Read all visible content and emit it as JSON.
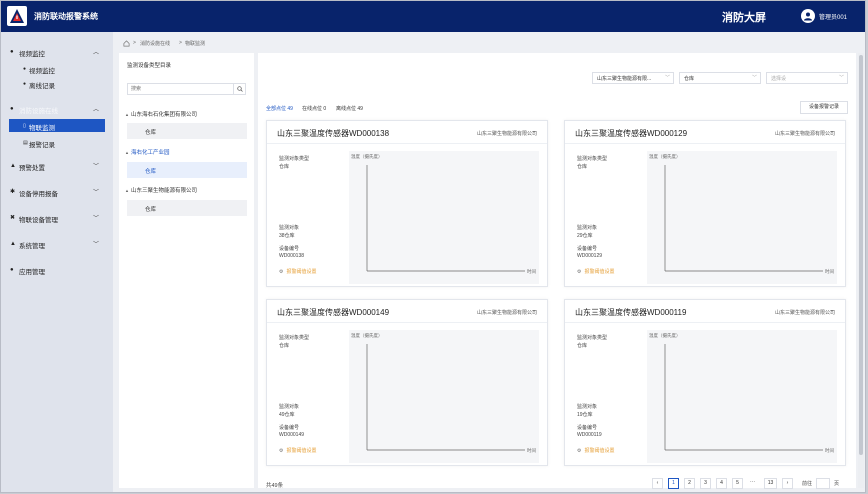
{
  "header": {
    "app_title": "消防联动报警系统",
    "big_screen": "消防大屏",
    "user_name": "管理员001"
  },
  "sidebar": {
    "groups": [
      {
        "label": "视频监控",
        "icon": "video-icon",
        "expanded": true,
        "children": [
          {
            "label": "视频监控"
          },
          {
            "label": "离线记录"
          }
        ]
      },
      {
        "label": "消防设施在线",
        "icon": "fire-icon",
        "expanded": true,
        "children": [
          {
            "label": "物联监测",
            "active": true
          },
          {
            "label": "报警记录"
          }
        ]
      },
      {
        "label": "预警处置",
        "icon": "warning-icon",
        "expanded": false
      },
      {
        "label": "设备停用报备",
        "icon": "device-icon",
        "expanded": false
      },
      {
        "label": "物联设备管理",
        "icon": "iot-icon",
        "expanded": false
      },
      {
        "label": "系统管理",
        "icon": "system-icon",
        "expanded": false
      },
      {
        "label": "应用管理",
        "icon": "app-icon",
        "expanded": false
      }
    ]
  },
  "breadcrumb": [
    "消防设施在线",
    "物联监测"
  ],
  "tree": {
    "title": "监测设备类型目录",
    "search_placeholder": "搜索",
    "nodes": [
      {
        "label": "山东海右石化集团有限公司",
        "children": [
          "仓库"
        ]
      },
      {
        "label": "海右化工产业园",
        "selected": true,
        "children": [
          "仓库"
        ]
      },
      {
        "label": "山东三聚生物能源有限公司",
        "children": [
          "仓库"
        ]
      }
    ]
  },
  "filters": {
    "company": "山东三聚生物能源有限...",
    "area": "仓库",
    "device_type_placeholder": "选择设"
  },
  "tabs": [
    {
      "label": "全部点位 49",
      "active": true
    },
    {
      "label": "在线点位 0"
    },
    {
      "label": "离线点位 49"
    }
  ],
  "alarm_button": "设备报警记录",
  "card_labels": {
    "object_type": "监测对象类型",
    "object": "监测对象",
    "device_no": "设备编号",
    "threshold": "报警阈值设置",
    "chart_ylabel": "温度（摄氏度）",
    "chart_xlabel": "时间"
  },
  "cards": [
    {
      "title": "山东三聚温度传感器WD000138",
      "org": "山东三聚生物能源有限公司",
      "object_type": "仓库",
      "object": "38仓库",
      "device_no": "WD000138"
    },
    {
      "title": "山东三聚温度传感器WD000129",
      "org": "山东三聚生物能源有限公司",
      "object_type": "仓库",
      "object": "29仓库",
      "device_no": "WD000129"
    },
    {
      "title": "山东三聚温度传感器WD000149",
      "org": "山东三聚生物能源有限公司",
      "object_type": "仓库",
      "object": "49仓库",
      "device_no": "WD000149"
    },
    {
      "title": "山东三聚温度传感器WD000119",
      "org": "山东三聚生物能源有限公司",
      "object_type": "仓库",
      "object": "19仓库",
      "device_no": "WD000119"
    }
  ],
  "pagination": {
    "total": "共49条",
    "pages": [
      "1",
      "2",
      "3",
      "4",
      "5",
      "···",
      "13"
    ],
    "current": "1",
    "goto_label": "前往",
    "page_unit": "页"
  },
  "colors": {
    "header_bg": "#08236b",
    "accent": "#1e56c3",
    "warning_link": "#e6a23c"
  }
}
